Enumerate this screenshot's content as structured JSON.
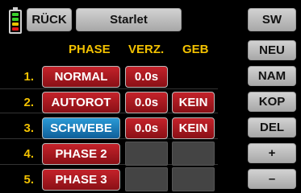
{
  "topbar": {
    "back_label": "RÜCK",
    "model_name": "Starlet"
  },
  "battery": {
    "icon": "battery-icon",
    "segment_colors": [
      "#3ad02c",
      "#3ad02c",
      "#e8c400",
      "#e01818"
    ]
  },
  "table": {
    "headers": {
      "phase": "PHASE",
      "delay": "VERZ.",
      "switch": "GEB"
    },
    "rows": [
      {
        "num": "1.",
        "phase": "NORMAL",
        "delay": "0.0s",
        "switch": "",
        "active": false
      },
      {
        "num": "2.",
        "phase": "AUTOROT",
        "delay": "0.0s",
        "switch": "KEIN",
        "active": false
      },
      {
        "num": "3.",
        "phase": "SCHWEBE",
        "delay": "0.0s",
        "switch": "KEIN",
        "active": true
      },
      {
        "num": "4.",
        "phase": "PHASE 2",
        "delay": "",
        "switch": "",
        "active": false
      },
      {
        "num": "5.",
        "phase": "PHASE 3",
        "delay": "",
        "switch": "",
        "active": false
      }
    ]
  },
  "sidebar": {
    "buttons": [
      "SW",
      "NEU",
      "NAM",
      "KOP",
      "DEL",
      "+",
      "–"
    ]
  },
  "colors": {
    "accent_yellow": "#f2c100",
    "phase_red": "#a8181f",
    "phase_active_blue": "#1a7cc0",
    "background": "#000000"
  }
}
